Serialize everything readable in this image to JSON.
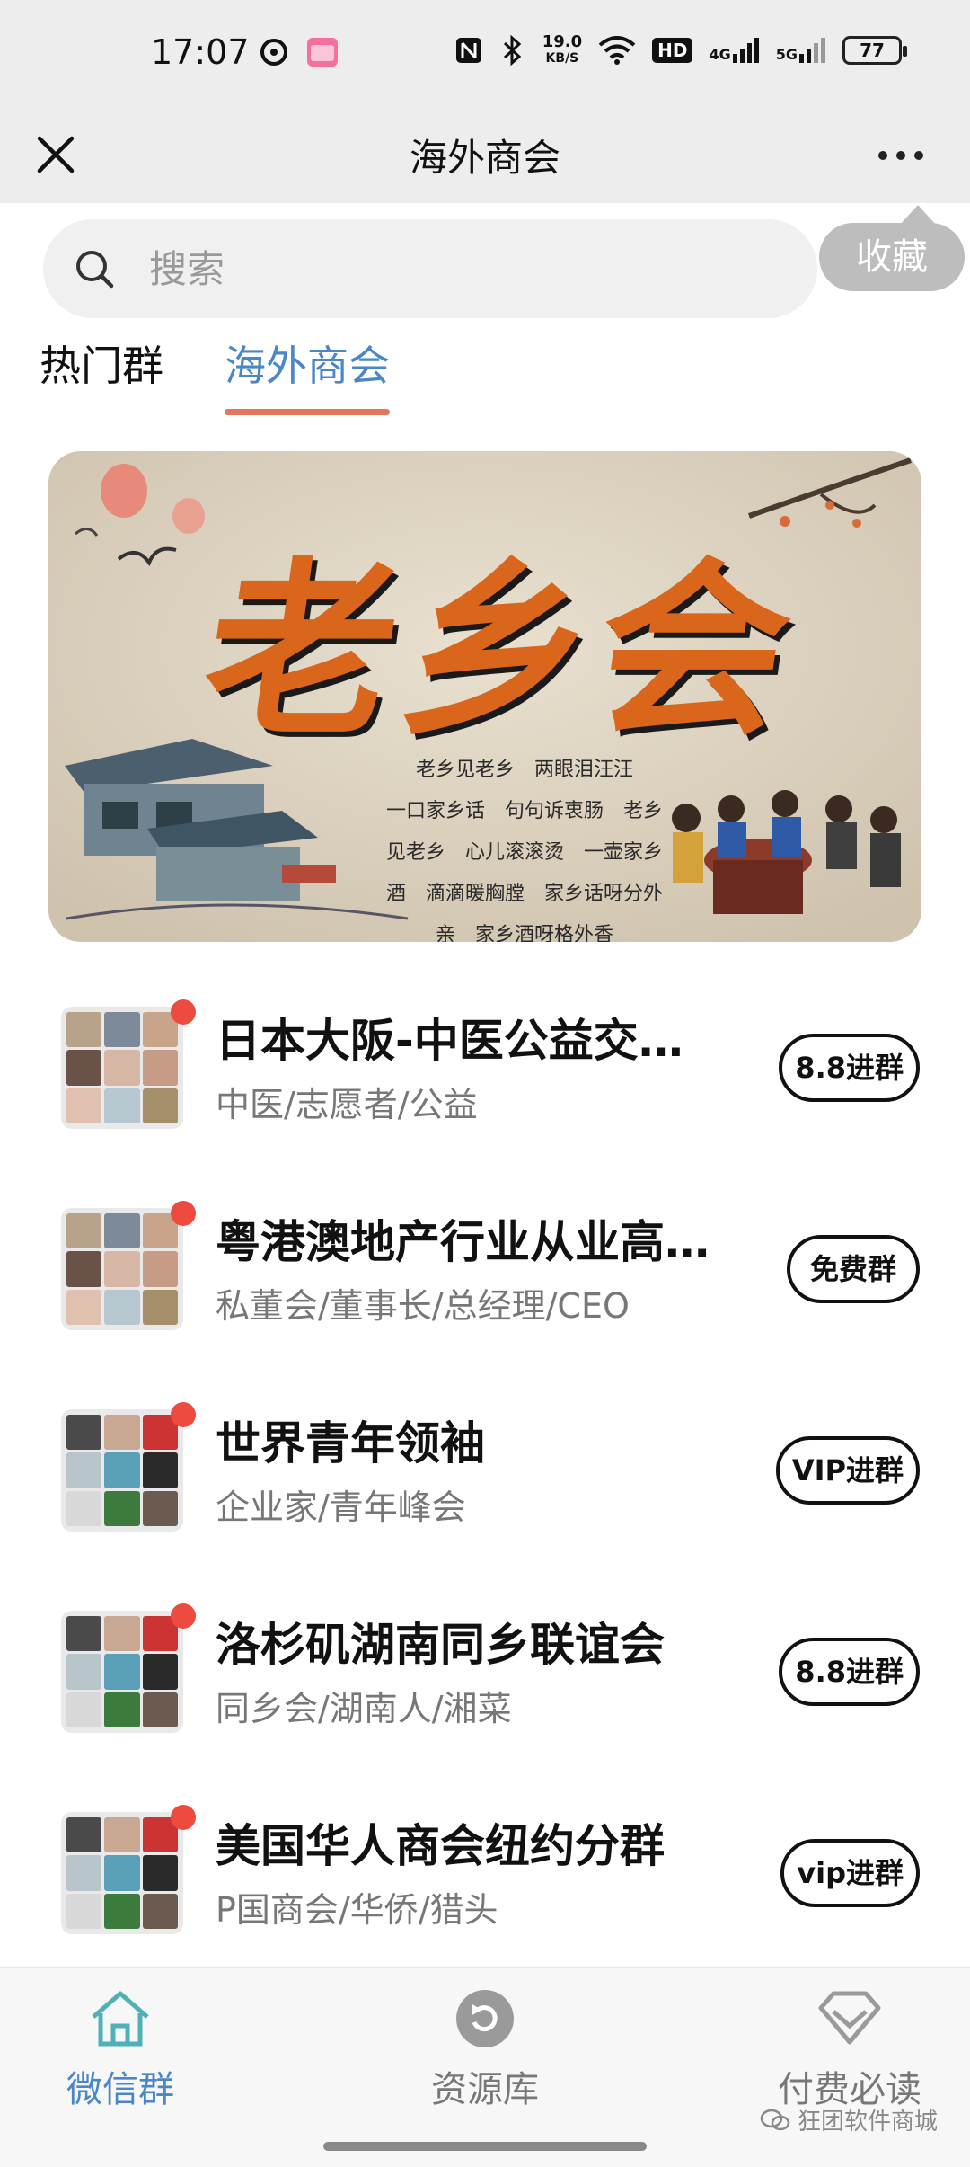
{
  "status_bar": {
    "time": "17:07",
    "network_speed_value": "19.0",
    "network_speed_unit": "KB/S",
    "hd_label": "HD",
    "signal1_label": "4G",
    "signal2_label": "5G",
    "battery": "77"
  },
  "nav": {
    "title": "海外商会"
  },
  "search": {
    "placeholder": "搜索"
  },
  "favorite_tip": "收藏",
  "tabs": [
    {
      "label": "热门群",
      "active": false
    },
    {
      "label": "海外商会",
      "active": true
    }
  ],
  "banner": {
    "title": "老乡会",
    "poem_lines": [
      "老乡见老乡　两眼泪汪汪",
      "一口家乡话　句句诉衷肠　老乡",
      "见老乡　心儿滚滚烫　一壶家乡",
      "酒　滴滴暖胸膛　家乡话呀分外",
      "亲　家乡酒呀格外香"
    ]
  },
  "groups": [
    {
      "title": "日本大阪-中医公益交…",
      "subtitle": "中医/志愿者/公益",
      "button": "8.8进群"
    },
    {
      "title": "粤港澳地产行业从业高…",
      "subtitle": "私董会/董事长/总经理/CEO",
      "button": "免费群"
    },
    {
      "title": "世界青年领袖",
      "subtitle": "企业家/青年峰会",
      "button": "VIP进群"
    },
    {
      "title": "洛杉矶湖南同乡联谊会",
      "subtitle": "同乡会/湖南人/湘菜",
      "button": "8.8进群"
    },
    {
      "title": "美国华人商会纽约分群",
      "subtitle": "P国商会/华侨/猎头",
      "button": "vip进群"
    }
  ],
  "bottom_nav": [
    {
      "label": "微信群",
      "icon": "home-icon",
      "active": true
    },
    {
      "label": "资源库",
      "icon": "refresh-circle-icon",
      "active": false
    },
    {
      "label": "付费必读",
      "icon": "diamond-icon",
      "active": false
    }
  ],
  "watermark": "狂团软件商城",
  "colors": {
    "accent_blue": "#4a86c8",
    "tab_underline": "#e2775e",
    "badge_red": "#ee4b40",
    "bar_bg": "#ededed"
  }
}
